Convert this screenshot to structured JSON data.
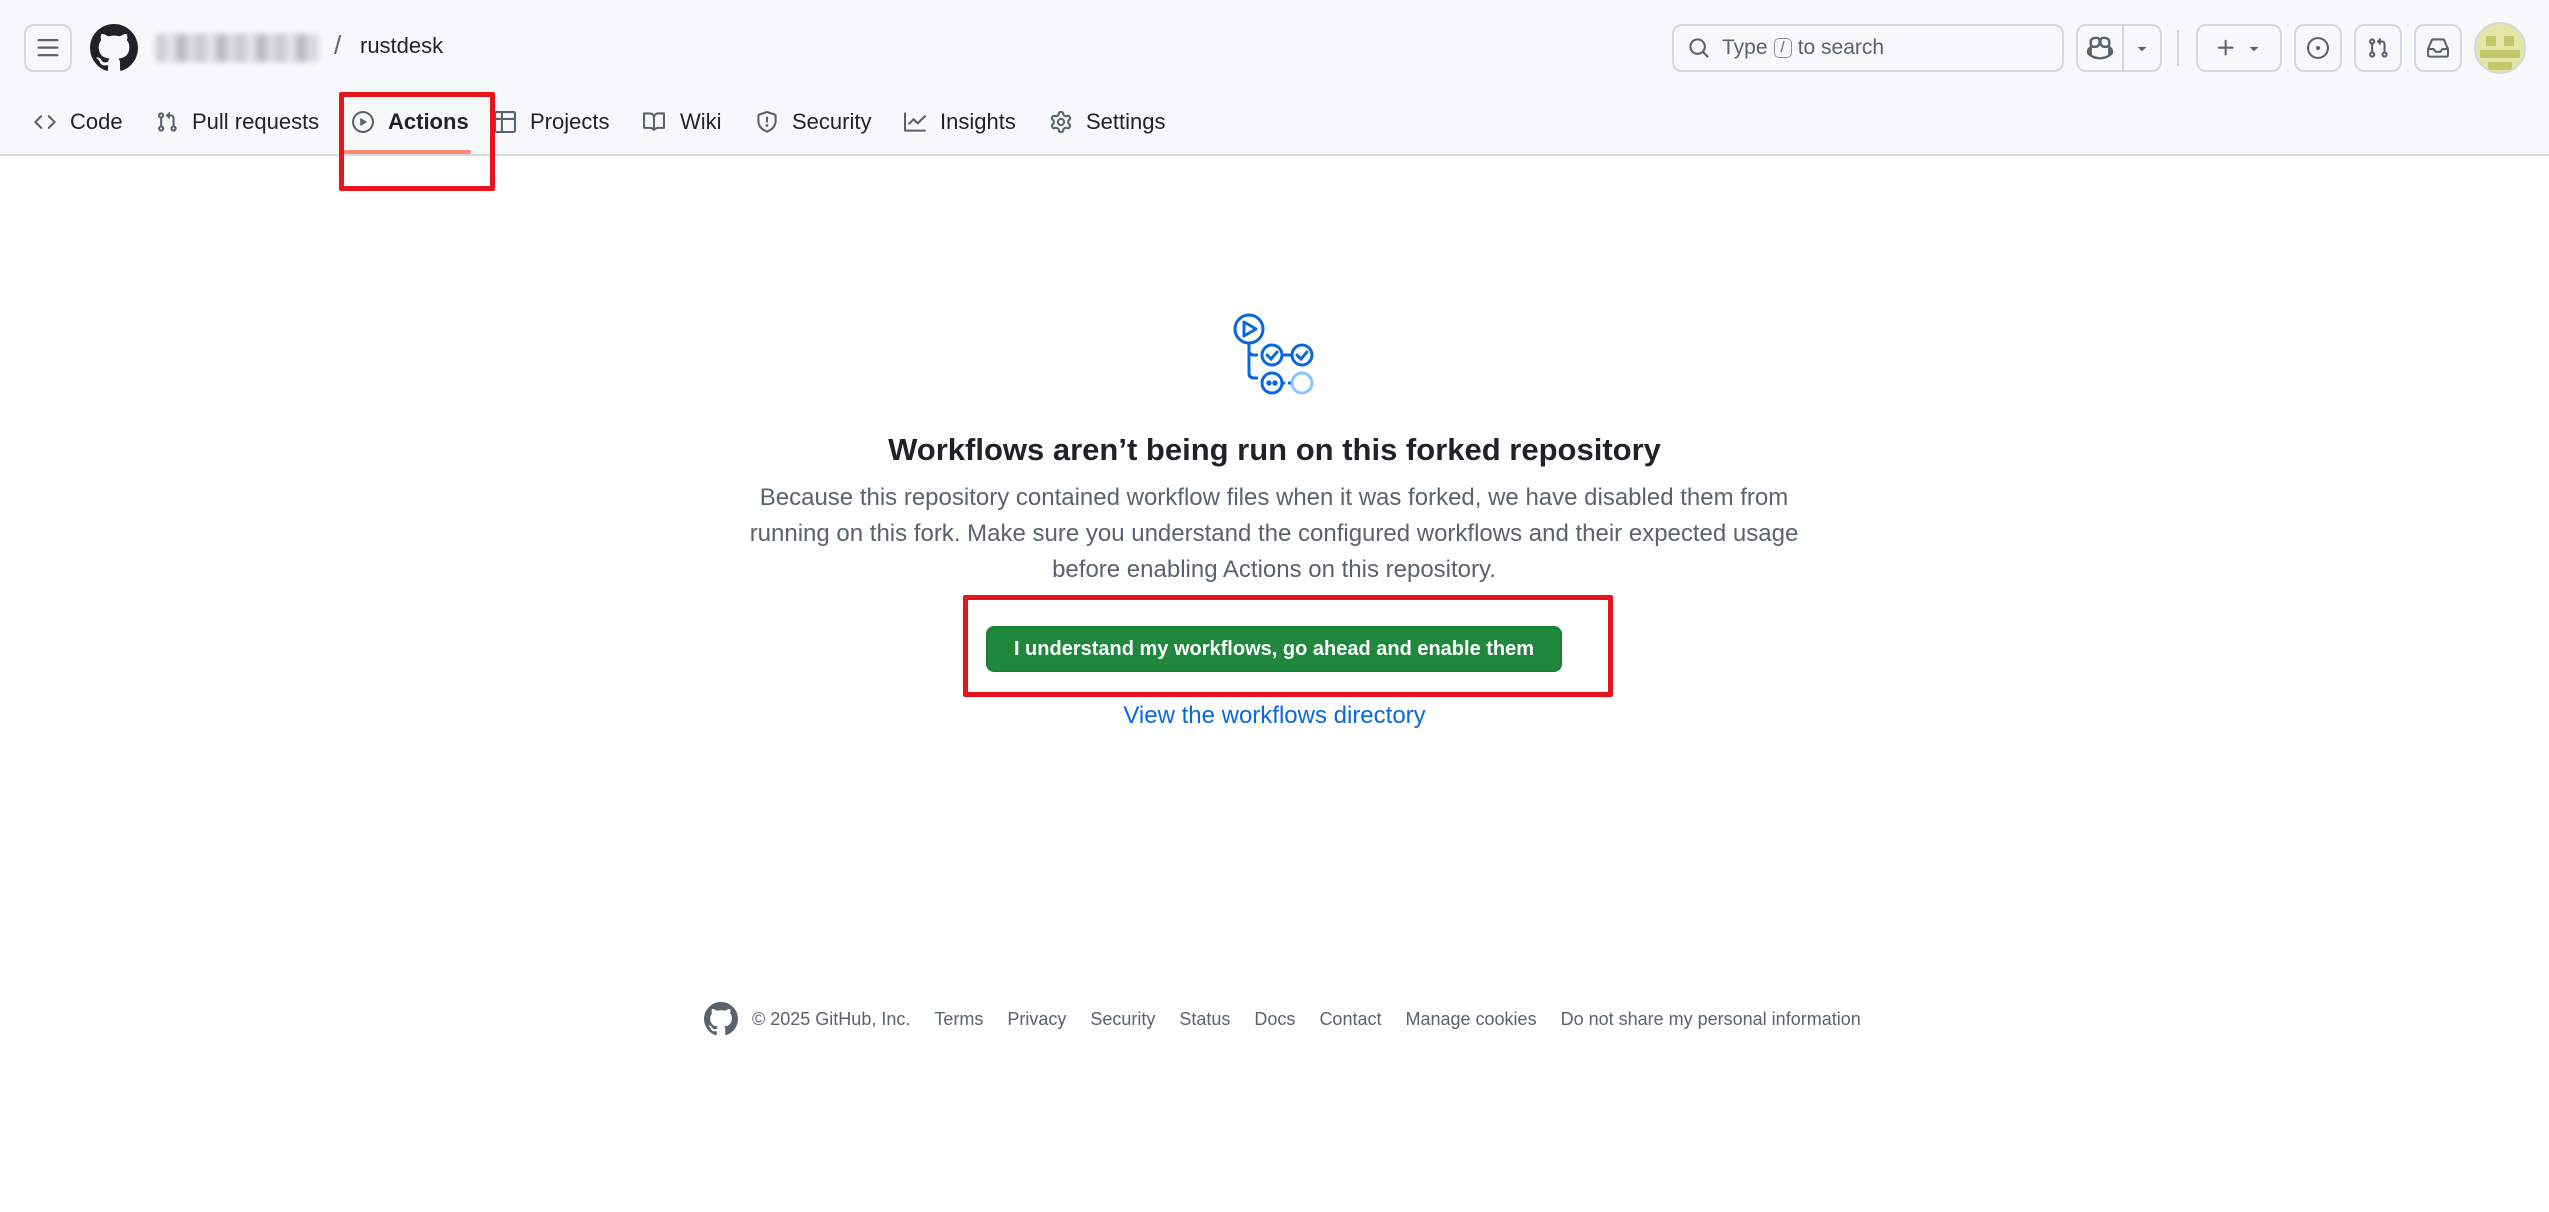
{
  "header": {
    "owner_name": "",
    "separator": "/",
    "repo_name": "rustdesk",
    "search": {
      "prefix": "Type",
      "key": "/",
      "suffix": "to search"
    },
    "icons": {
      "menu": "hamburger-icon",
      "logo": "github-logo-icon",
      "copilot": "copilot-icon",
      "create": "plus-icon",
      "issues": "issue-opened-icon",
      "pulls": "git-pull-request-icon",
      "inbox": "inbox-icon"
    }
  },
  "tabs": [
    {
      "label": "Code",
      "icon": "code-icon"
    },
    {
      "label": "Pull requests",
      "icon": "git-pull-request-icon"
    },
    {
      "label": "Actions",
      "icon": "play-icon",
      "active": true
    },
    {
      "label": "Projects",
      "icon": "table-icon"
    },
    {
      "label": "Wiki",
      "icon": "book-icon"
    },
    {
      "label": "Security",
      "icon": "shield-icon"
    },
    {
      "label": "Insights",
      "icon": "graph-icon"
    },
    {
      "label": "Settings",
      "icon": "gear-icon"
    }
  ],
  "main": {
    "title": "Workflows aren’t being run on this forked repository",
    "description": "Because this repository contained workflow files when it was forked, we have disabled them from running on this fork. Make sure you understand the configured workflows and their expected usage before enabling Actions on this repository.",
    "enable_button": "I understand my workflows, go ahead and enable them",
    "directory_link": "View the workflows directory"
  },
  "footer": {
    "copyright": "© 2025 GitHub, Inc.",
    "links": [
      "Terms",
      "Privacy",
      "Security",
      "Status",
      "Docs",
      "Contact",
      "Manage cookies",
      "Do not share my personal information"
    ]
  },
  "colors": {
    "accent_green": "#1f883d",
    "link_blue": "#0969da",
    "active_tab_underline": "#fd8c73",
    "annotation_red": "#e8141c"
  }
}
